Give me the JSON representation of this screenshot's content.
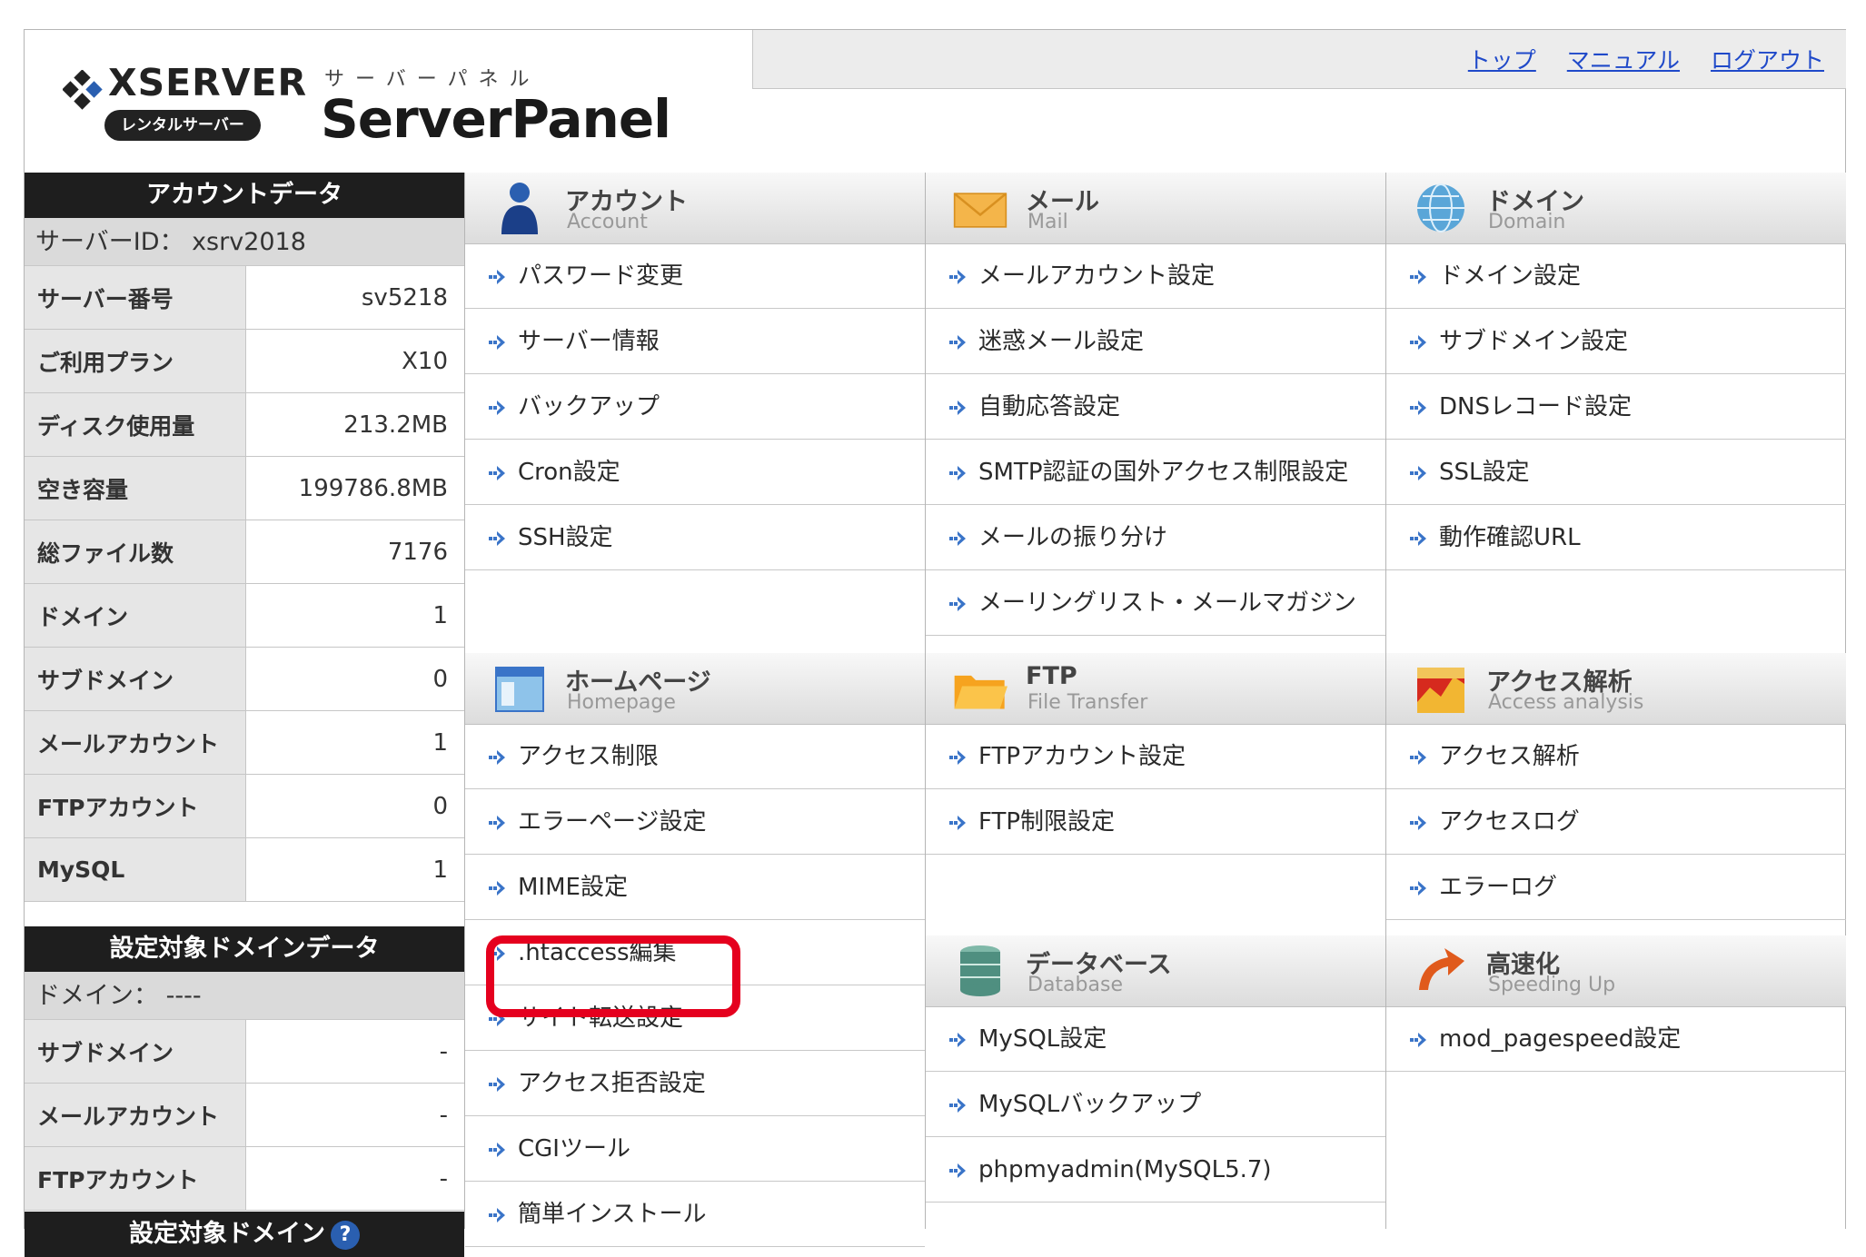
{
  "header": {
    "brand_name": "XSERVER",
    "brand_tag": "レンタルサーバー",
    "product_kana": "サーバーパネル",
    "product_name": "ServerPanel",
    "nav": [
      "トップ",
      "マニュアル",
      "ログアウト"
    ]
  },
  "sidebar": {
    "account_title": "アカウントデータ",
    "server_id_label": "サーバーID：",
    "server_id_value": "xsrv2018",
    "account_rows": [
      {
        "label": "サーバー番号",
        "value": "sv5218"
      },
      {
        "label": "ご利用プラン",
        "value": "X10"
      },
      {
        "label": "ディスク使用量",
        "value": "213.2MB"
      },
      {
        "label": "空き容量",
        "value": "199786.8MB"
      },
      {
        "label": "総ファイル数",
        "value": "7176"
      },
      {
        "label": "ドメイン",
        "value": "1"
      },
      {
        "label": "サブドメイン",
        "value": "0"
      },
      {
        "label": "メールアカウント",
        "value": "1"
      },
      {
        "label": "FTPアカウント",
        "value": "0"
      },
      {
        "label": "MySQL",
        "value": "1"
      }
    ],
    "domain_title": "設定対象ドメインデータ",
    "domain_label": "ドメイン：",
    "domain_value": "----",
    "domain_rows": [
      {
        "label": "サブドメイン",
        "value": "-"
      },
      {
        "label": "メールアカウント",
        "value": "-"
      },
      {
        "label": "FTPアカウント",
        "value": "-"
      }
    ],
    "bottom_title": "設定対象ドメイン",
    "help_glyph": "?"
  },
  "sections": {
    "account": {
      "jp": "アカウント",
      "en": "Account",
      "items": [
        "パスワード変更",
        "サーバー情報",
        "バックアップ",
        "Cron設定",
        "SSH設定"
      ]
    },
    "mail": {
      "jp": "メール",
      "en": "Mail",
      "items": [
        "メールアカウント設定",
        "迷惑メール設定",
        "自動応答設定",
        "SMTP認証の国外アクセス制限設定",
        "メールの振り分け",
        "メーリングリスト・メールマガジン"
      ]
    },
    "domain": {
      "jp": "ドメイン",
      "en": "Domain",
      "items": [
        "ドメイン設定",
        "サブドメイン設定",
        "DNSレコード設定",
        "SSL設定",
        "動作確認URL"
      ]
    },
    "homepage": {
      "jp": "ホームページ",
      "en": "Homepage",
      "items": [
        "アクセス制限",
        "エラーページ設定",
        "MIME設定",
        ".htaccess編集",
        "サイト転送設定",
        "アクセス拒否設定",
        "CGIツール",
        "簡単インストール"
      ]
    },
    "ftp": {
      "jp": "FTP",
      "en": "File Transfer",
      "items": [
        "FTPアカウント設定",
        "FTP制限設定"
      ]
    },
    "access": {
      "jp": "アクセス解析",
      "en": "Access analysis",
      "items": [
        "アクセス解析",
        "アクセスログ",
        "エラーログ"
      ]
    },
    "database": {
      "jp": "データベース",
      "en": "Database",
      "items": [
        "MySQL設定",
        "MySQLバックアップ",
        "phpmyadmin(MySQL5.7)"
      ]
    },
    "speed": {
      "jp": "高速化",
      "en": "Speeding Up",
      "items": [
        "mod_pagespeed設定"
      ]
    }
  },
  "highlighted_item": ".htaccess編集",
  "colors": {
    "link": "#1f49c9",
    "highlight": "#e5001e",
    "dark_header": "#1e1e1e"
  }
}
